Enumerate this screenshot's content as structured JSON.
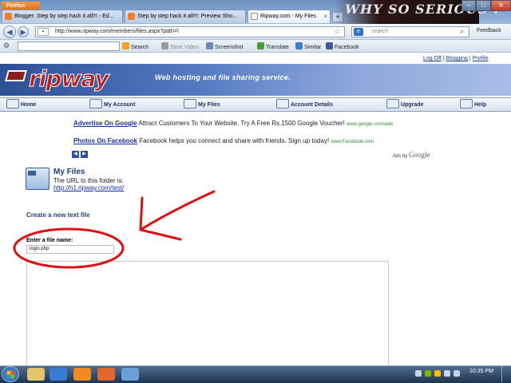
{
  "browser": {
    "app_button": "Firefox",
    "tabs": [
      {
        "label": "Blogger: Step by step hack it all!!! - Ed...",
        "active": false
      },
      {
        "label": "Step by step hack it all!!!: Preview Sho...",
        "active": false
      },
      {
        "label": "Ripway.com - My Files",
        "active": true
      }
    ],
    "banner_text": "WHY SO SERIOUS ?",
    "url": "http://www.ripway.com/members/files.aspx?path=\\",
    "search_placeholder": "search",
    "feedback_label": "Feedback",
    "toolbar": {
      "search_label": "Search",
      "save_video_label": "Save Video",
      "screenshot_label": "Screenshot",
      "translate_label": "Translate",
      "similar_label": "Similar",
      "facebook_label": "Facebook"
    }
  },
  "page": {
    "top_links": {
      "logoff": "Log Off",
      "blogging": "Blogging",
      "profile": "Profile"
    },
    "logo": "ripway",
    "tagline": "Web hosting and file sharing service.",
    "menu": [
      {
        "label": "Home",
        "icon": "home-icon"
      },
      {
        "label": "My Account",
        "icon": "account-icon"
      },
      {
        "label": "My Files",
        "icon": "files-icon"
      },
      {
        "label": "Account Details",
        "icon": "details-icon"
      },
      {
        "label": "Upgrade",
        "icon": "upgrade-icon"
      },
      {
        "label": "Help",
        "icon": "help-icon"
      }
    ],
    "ads": [
      {
        "title": "Advertise On Google",
        "text": "Attract Customers To Your Website. Try A Free Rs.1500 Google Voucher!",
        "url": "www.google.com/adw"
      },
      {
        "title": "Photos On Facebook",
        "text": "Facebook helps you connect and share with friends. Sign up today!",
        "url": "www.Facebook.com"
      }
    ],
    "ads_by": "Ads by",
    "ads_brand": "Google",
    "files": {
      "title": "My Files",
      "description": "The URL to this folder is:",
      "folder_url": "http://h1.ripway.com/test/"
    },
    "create": {
      "title": "Create a new text file",
      "filename_label": "Enter a file name:",
      "filename_value": "login.php"
    }
  },
  "taskbar": {
    "clock": "10:35 PM"
  },
  "colors": {
    "annotation": "#e01010",
    "header_blue": "#2d4f96",
    "logo_red": "#b62020"
  }
}
